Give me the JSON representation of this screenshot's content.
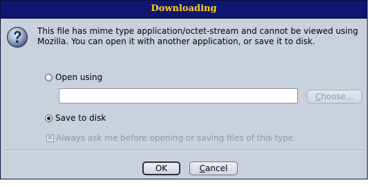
{
  "window": {
    "title": "Downloading"
  },
  "icons": {
    "question": "question-icon"
  },
  "message": {
    "text": "This file has mime type application/octet-stream and cannot be viewed using Mozilla. You can open it with another application, or save it to disk."
  },
  "options": {
    "open_using": {
      "label": "Open using",
      "selected": false
    },
    "app_path": {
      "value": "",
      "placeholder": ""
    },
    "choose_button": {
      "label_underlined": "C",
      "label_rest": "hoose...",
      "enabled": false
    },
    "save_to_disk": {
      "label": "Save to disk",
      "selected": true
    },
    "always_ask": {
      "label": "Always ask me before opening or saving files of this type.",
      "checked": true,
      "enabled": false
    }
  },
  "buttons": {
    "ok": "OK",
    "cancel_underlined": "C",
    "cancel_rest": "ancel"
  },
  "colors": {
    "titlebar_bg": "#0e1670",
    "title_text": "#ffd21a",
    "dialog_bg": "#c9d1dd"
  }
}
